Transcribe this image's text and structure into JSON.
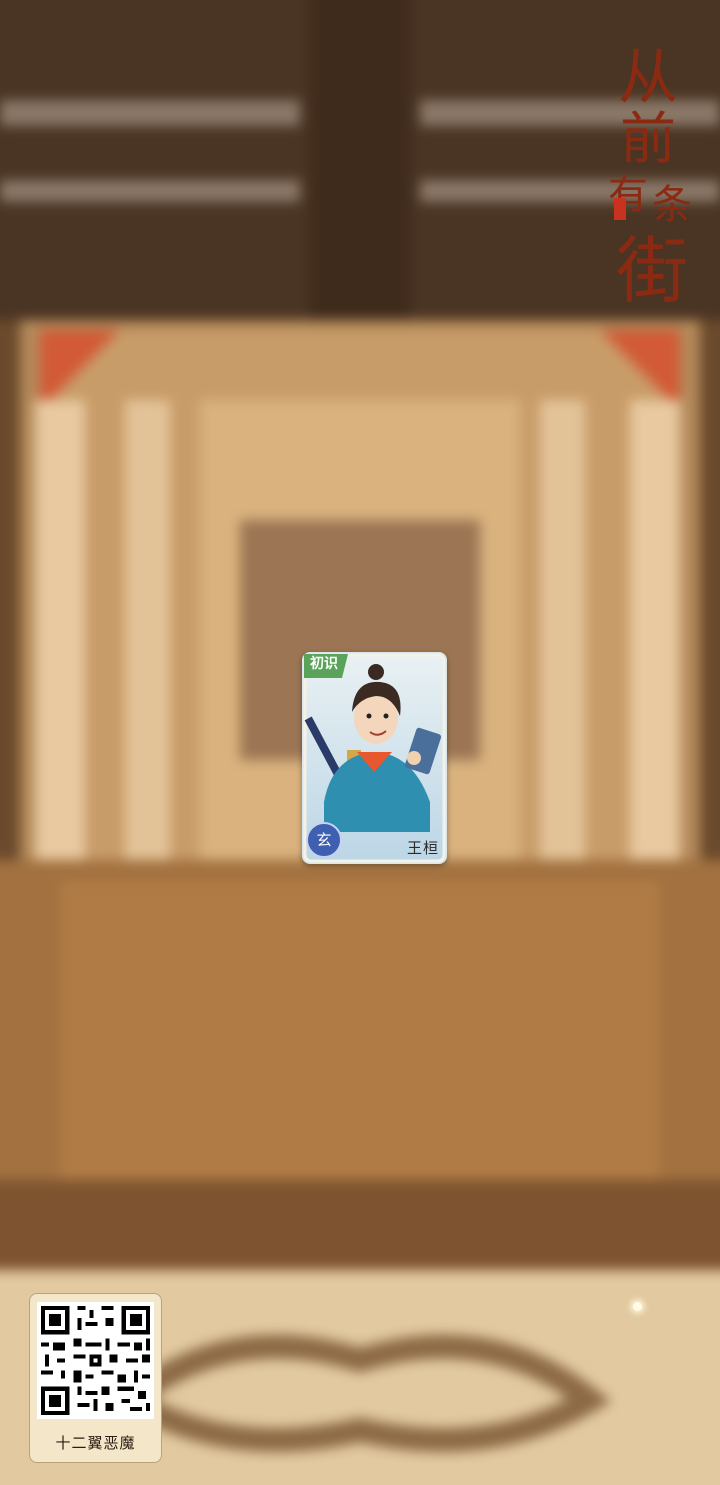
{
  "game": {
    "logo_text": [
      "从",
      "前",
      "有",
      "条",
      "街"
    ]
  },
  "card": {
    "tag": "初识",
    "grade": "玄",
    "name": "王桓"
  },
  "qr": {
    "label": "十二翼恶魔"
  },
  "colors": {
    "background_wood": "#7a5534",
    "card_frame": "#dbe6ec",
    "grade_badge": "#3f5fb0",
    "tag_green": "#5aa35a",
    "logo_red": "#8a2a12"
  }
}
